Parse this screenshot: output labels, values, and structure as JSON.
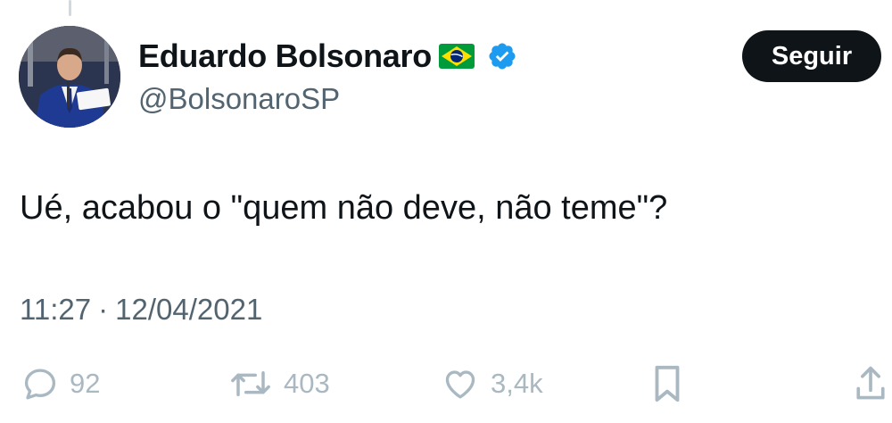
{
  "author": {
    "display_name": "Eduardo Bolsonaro",
    "flag_icon": "brazil-flag-icon",
    "verified_icon": "verified-badge-icon",
    "handle": "@BolsonaroSP"
  },
  "follow_button": {
    "label": "Seguir"
  },
  "tweet": {
    "text": "Ué, acabou o \"quem não deve, não teme\"?",
    "time": "11:27",
    "separator": "·",
    "date": "12/04/2021"
  },
  "actions": {
    "reply": {
      "icon": "reply-icon",
      "count": "92"
    },
    "retweet": {
      "icon": "retweet-icon",
      "count": "403"
    },
    "like": {
      "icon": "heart-icon",
      "count": "3,4k"
    },
    "bookmark": {
      "icon": "bookmark-icon"
    },
    "share": {
      "icon": "share-icon"
    }
  },
  "colors": {
    "text_primary": "#0f1419",
    "text_secondary": "#536471",
    "verified_blue": "#1d9bf0",
    "follow_button_bg": "#0f1419",
    "action_icon": "#aab8c2"
  }
}
